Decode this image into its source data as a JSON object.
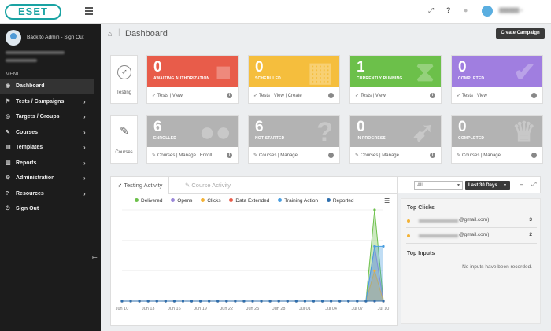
{
  "header": {
    "logo": "ESET",
    "icons": [
      "expand-icon",
      "help-icon",
      "bell-icon",
      "user-avatar-icon"
    ]
  },
  "sidebar": {
    "back_link": "Back to Admin - Sign Out",
    "menu_label": "MENU",
    "items": [
      {
        "label": "Dashboard",
        "icon": "dashboard-icon",
        "active": true,
        "has_children": false
      },
      {
        "label": "Tests / Campaigns",
        "icon": "tests-icon",
        "active": false,
        "has_children": true
      },
      {
        "label": "Targets / Groups",
        "icon": "targets-icon",
        "active": false,
        "has_children": true
      },
      {
        "label": "Courses",
        "icon": "courses-icon",
        "active": false,
        "has_children": true
      },
      {
        "label": "Templates",
        "icon": "templates-icon",
        "active": false,
        "has_children": true
      },
      {
        "label": "Reports",
        "icon": "reports-icon",
        "active": false,
        "has_children": true
      },
      {
        "label": "Administration",
        "icon": "administration-icon",
        "active": false,
        "has_children": true
      },
      {
        "label": "Resources",
        "icon": "resources-icon",
        "active": false,
        "has_children": true
      },
      {
        "label": "Sign Out",
        "icon": "sign-out-icon",
        "active": false,
        "has_children": false
      }
    ]
  },
  "page": {
    "title": "Dashboard",
    "create_button": "Create Campaign"
  },
  "testing_row": {
    "label": "Testing",
    "cards": [
      {
        "number": "0",
        "caption": "AWAITING AUTHORIZATION",
        "color": "#e85c4a",
        "links": "Tests | View"
      },
      {
        "number": "0",
        "caption": "SCHEDULED",
        "color": "#f5be3d",
        "links": "Tests | View | Create"
      },
      {
        "number": "1",
        "caption": "CURRENTLY RUNNING",
        "color": "#6cc04a",
        "links": "Tests | View"
      },
      {
        "number": "0",
        "caption": "COMPLETED",
        "color": "#a07ee0",
        "links": "Tests | View"
      }
    ]
  },
  "courses_row": {
    "label": "Courses",
    "cards": [
      {
        "number": "6",
        "caption": "ENROLLED",
        "color": "#b3b3b3",
        "links": "Courses | Manage | Enroll"
      },
      {
        "number": "6",
        "caption": "NOT STARTED",
        "color": "#b3b3b3",
        "links": "Courses | Manage"
      },
      {
        "number": "0",
        "caption": "IN PROGRESS",
        "color": "#b3b3b3",
        "links": "Courses | Manage"
      },
      {
        "number": "0",
        "caption": "COMPLETED",
        "color": "#b3b3b3",
        "links": "Courses | Manage"
      }
    ]
  },
  "activity": {
    "tabs": [
      "Testing Activity",
      "Course Activity"
    ],
    "filter_value": "All",
    "range_value": "Last 30 Days"
  },
  "top_clicks": {
    "heading": "Top Clicks",
    "rows": [
      {
        "email_suffix": "@gmail.com)",
        "count": "3"
      },
      {
        "email_suffix": "@gmail.com)",
        "count": "2"
      }
    ]
  },
  "top_inputs": {
    "heading": "Top Inputs",
    "empty_text": "No inputs have been recorded."
  },
  "chart_data": {
    "type": "line",
    "categories": [
      "Jun 10",
      "Jun 11",
      "Jun 12",
      "Jun 13",
      "Jun 14",
      "Jun 15",
      "Jun 16",
      "Jun 17",
      "Jun 18",
      "Jun 19",
      "Jun 20",
      "Jun 21",
      "Jun 22",
      "Jun 23",
      "Jun 24",
      "Jun 25",
      "Jun 26",
      "Jun 27",
      "Jun 28",
      "Jun 29",
      "Jun 30",
      "Jul 01",
      "Jul 02",
      "Jul 03",
      "Jul 04",
      "Jul 05",
      "Jul 06",
      "Jul 07",
      "Jul 08",
      "Jul 09",
      "Jul 10"
    ],
    "x_tick_labels": [
      "Jun 10",
      "Jun 13",
      "Jun 16",
      "Jun 19",
      "Jun 22",
      "Jun 25",
      "Jun 28",
      "Jul 01",
      "Jul 04",
      "Jul 07",
      "Jul 10"
    ],
    "ylim": [
      0,
      3
    ],
    "series": [
      {
        "name": "Delivered",
        "color": "#6cc04a",
        "values": [
          0,
          0,
          0,
          0,
          0,
          0,
          0,
          0,
          0,
          0,
          0,
          0,
          0,
          0,
          0,
          0,
          0,
          0,
          0,
          0,
          0,
          0,
          0,
          0,
          0,
          0,
          0,
          0,
          0,
          3,
          0
        ]
      },
      {
        "name": "Opens",
        "color": "#9b88d8",
        "values": [
          0,
          0,
          0,
          0,
          0,
          0,
          0,
          0,
          0,
          0,
          0,
          0,
          0,
          0,
          0,
          0,
          0,
          0,
          0,
          0,
          0,
          0,
          0,
          0,
          0,
          0,
          0,
          0,
          0,
          1.8,
          0
        ]
      },
      {
        "name": "Clicks",
        "color": "#f3b236",
        "values": [
          0,
          0,
          0,
          0,
          0,
          0,
          0,
          0,
          0,
          0,
          0,
          0,
          0,
          0,
          0,
          0,
          0,
          0,
          0,
          0,
          0,
          0,
          0,
          0,
          0,
          0,
          0,
          0,
          0,
          1,
          0
        ]
      },
      {
        "name": "Data Extended",
        "color": "#e85c4a",
        "values": [
          0,
          0,
          0,
          0,
          0,
          0,
          0,
          0,
          0,
          0,
          0,
          0,
          0,
          0,
          0,
          0,
          0,
          0,
          0,
          0,
          0,
          0,
          0,
          0,
          0,
          0,
          0,
          0,
          0,
          0,
          0
        ]
      },
      {
        "name": "Training Action",
        "color": "#4a9ee0",
        "values": [
          0,
          0,
          0,
          0,
          0,
          0,
          0,
          0,
          0,
          0,
          0,
          0,
          0,
          0,
          0,
          0,
          0,
          0,
          0,
          0,
          0,
          0,
          0,
          0,
          0,
          0,
          0,
          0,
          0,
          1.8,
          1.8
        ]
      },
      {
        "name": "Reported",
        "color": "#2f6fae",
        "values": [
          0,
          0,
          0,
          0,
          0,
          0,
          0,
          0,
          0,
          0,
          0,
          0,
          0,
          0,
          0,
          0,
          0,
          0,
          0,
          0,
          0,
          0,
          0,
          0,
          0,
          0,
          0,
          0,
          0,
          0,
          0
        ]
      }
    ]
  }
}
